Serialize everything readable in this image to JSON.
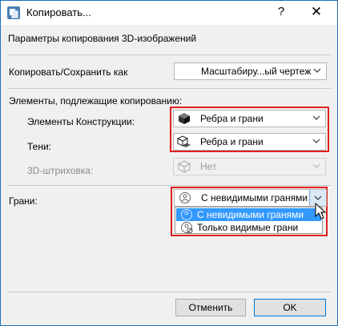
{
  "window": {
    "title": "Копировать...",
    "help_label": "?",
    "close_label": "✕"
  },
  "section": {
    "title": "Параметры копирования 3D-изображений"
  },
  "copy_as": {
    "label": "Копировать/Сохранить как",
    "value": "Масштабиру...ый чертеж"
  },
  "elements": {
    "heading": "Элементы, подлежащие копированию:",
    "construction": {
      "label": "Элементы Конструкции:",
      "value": "Ребра и грани",
      "icon": "solid-cube-icon"
    },
    "shadows": {
      "label": "Тени:",
      "value": "Ребра и грани",
      "icon": "shadow-cube-icon"
    },
    "hatching": {
      "label": "3D-штриховка:",
      "value": "Нет",
      "icon": "wire-cube-icon"
    }
  },
  "faces": {
    "label": "Грани:",
    "value": "С невидимыми гранями",
    "options": [
      "С невидимыми гранями",
      "Только видимые грани"
    ]
  },
  "buttons": {
    "cancel": "Отменить",
    "ok": "OK"
  },
  "colors": {
    "highlight": "#e02020",
    "selection": "#3399ff",
    "accent": "#0078d7"
  }
}
